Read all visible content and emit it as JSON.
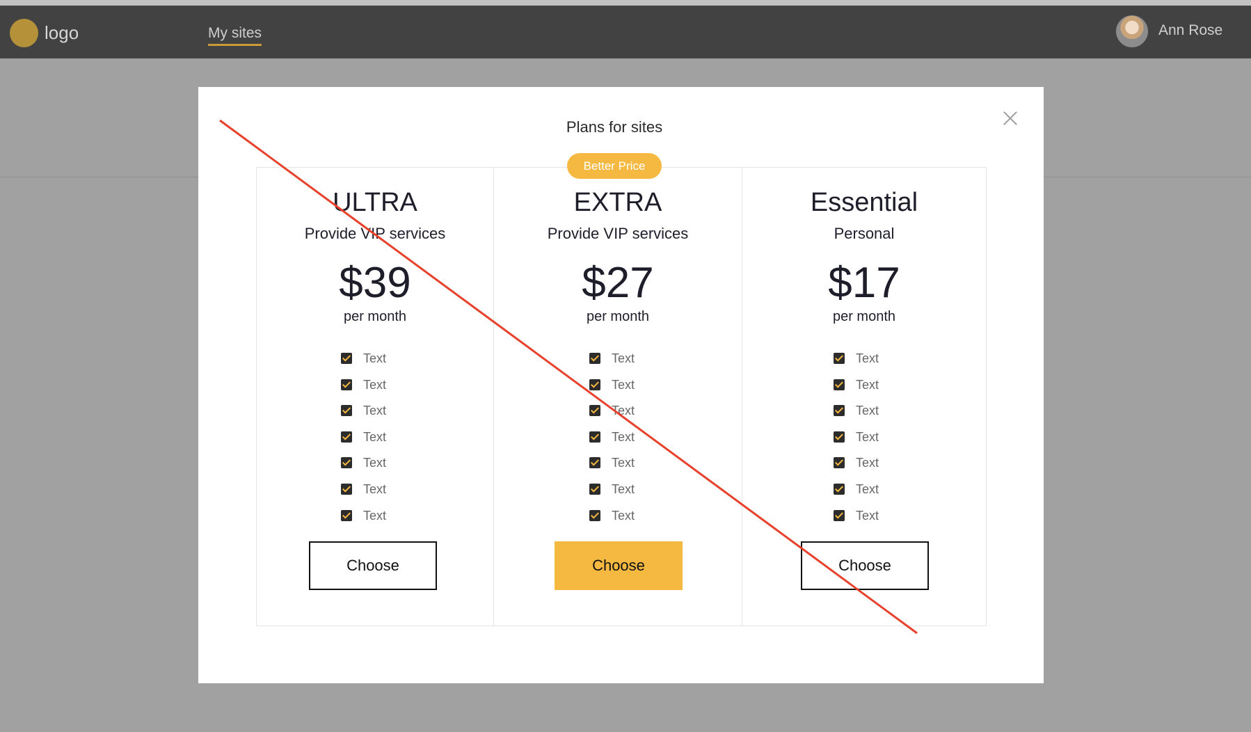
{
  "navbar": {
    "logo_text": "logo",
    "nav_link": "My sites",
    "user_name": "Ann Rose"
  },
  "modal": {
    "title": "Plans for sites",
    "badge": "Better Price",
    "plans": [
      {
        "name": "ULTRA",
        "subtitle": "Provide VIP services",
        "price": "$39",
        "period": "per month",
        "features": [
          "Text",
          "Text",
          "Text",
          "Text",
          "Text",
          "Text",
          "Text"
        ],
        "button": "Choose"
      },
      {
        "name": "EXTRA",
        "subtitle": "Provide VIP services",
        "price": "$27",
        "period": "per month",
        "features": [
          "Text",
          "Text",
          "Text",
          "Text",
          "Text",
          "Text",
          "Text"
        ],
        "button": "Choose"
      },
      {
        "name": "Essential",
        "subtitle": "Personal",
        "price": "$17",
        "period": "per month",
        "features": [
          "Text",
          "Text",
          "Text",
          "Text",
          "Text",
          "Text",
          "Text"
        ],
        "button": "Choose"
      }
    ]
  },
  "colors": {
    "accent": "#f5b942",
    "navbar": "#424242",
    "backdrop": "#a1a1a1",
    "strike_line": "#e8412b"
  }
}
